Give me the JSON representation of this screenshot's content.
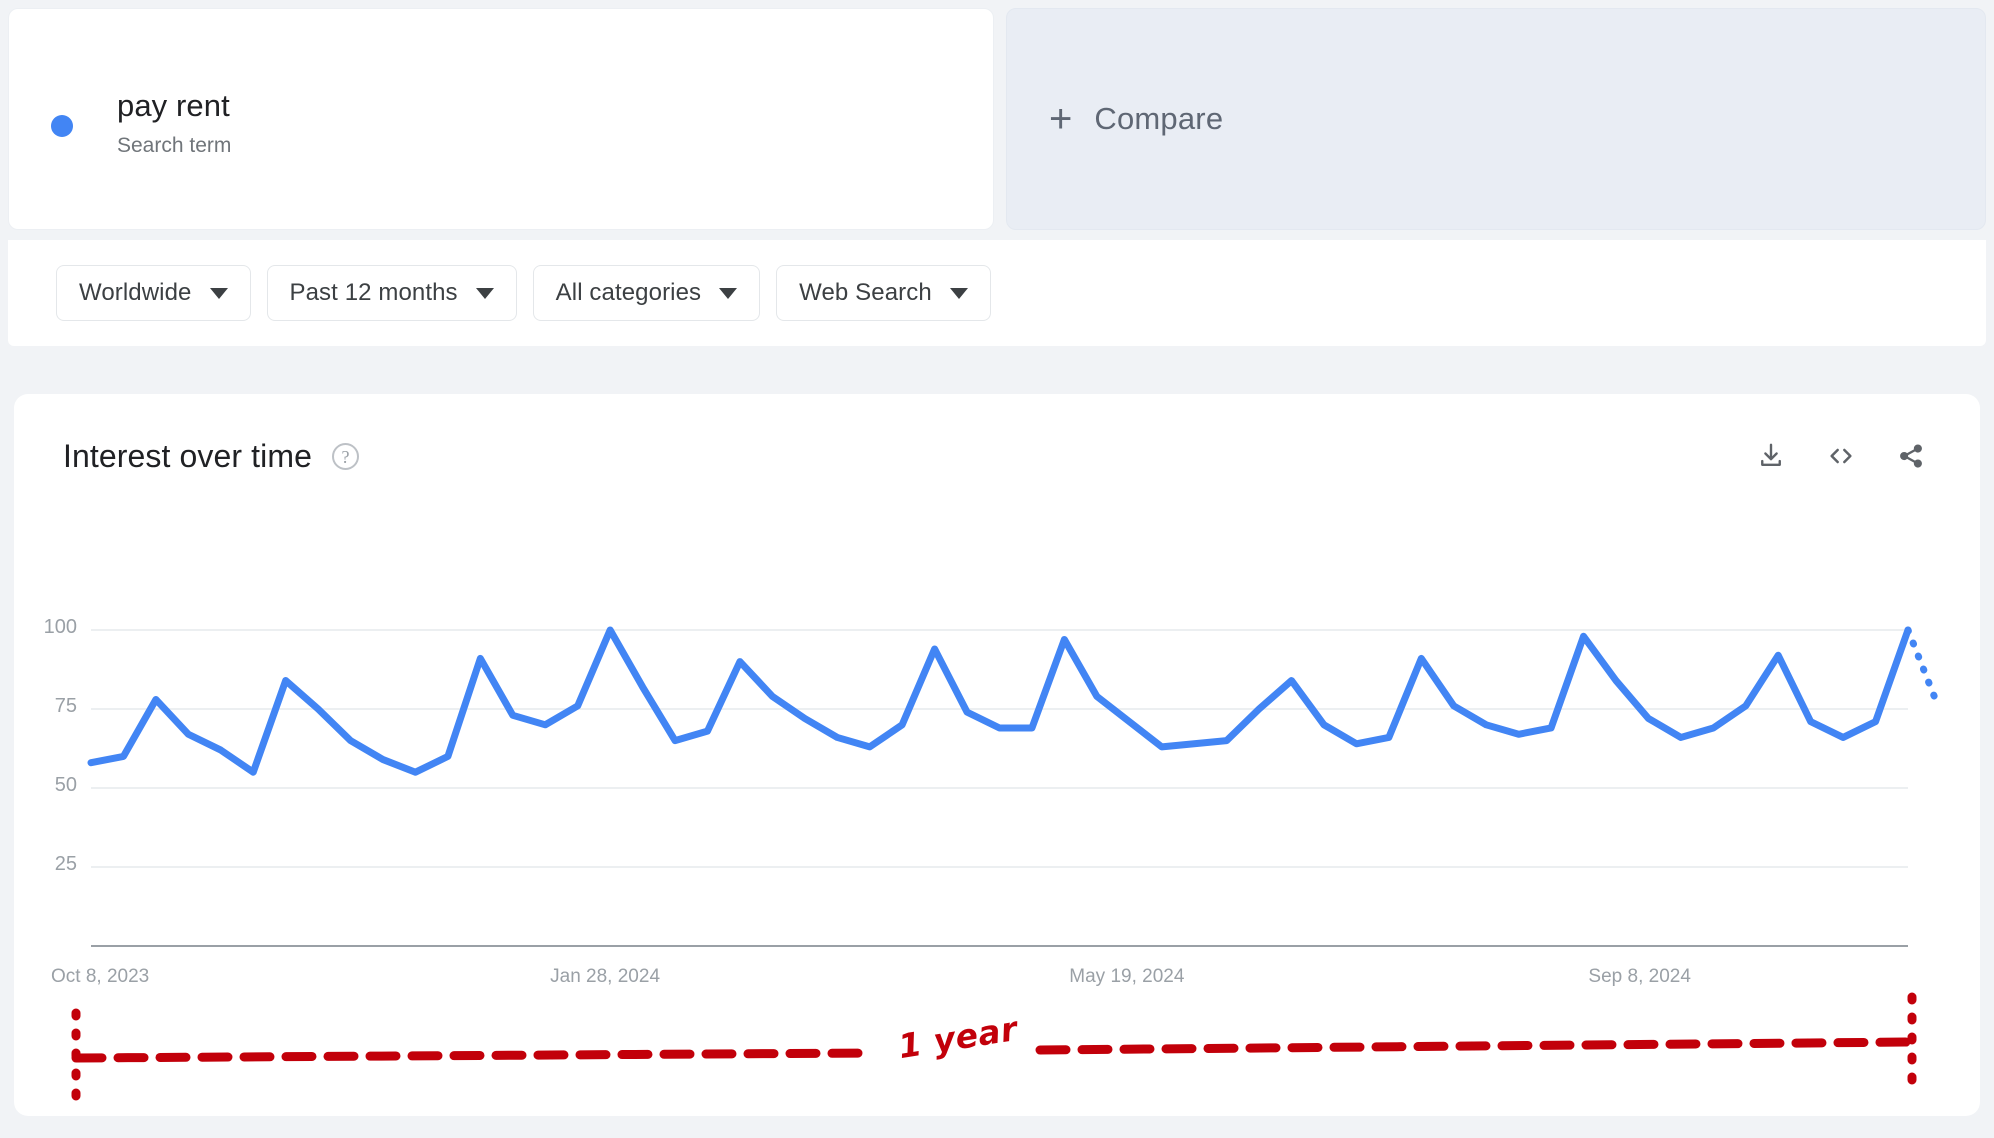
{
  "term_card": {
    "title": "pay rent",
    "subtitle": "Search term",
    "dot_color": "#4285f4"
  },
  "compare_card": {
    "plus": "+",
    "label": "Compare",
    "background": "#e9edf4"
  },
  "filters": [
    {
      "label": "Worldwide",
      "icon": "chevron-down-icon"
    },
    {
      "label": "Past 12 months",
      "icon": "chevron-down-icon"
    },
    {
      "label": "All categories",
      "icon": "chevron-down-icon"
    },
    {
      "label": "Web Search",
      "icon": "chevron-down-icon"
    }
  ],
  "chart_card": {
    "title": "Interest over time",
    "help_glyph": "?",
    "actions": [
      {
        "name": "download-icon",
        "label": "Download"
      },
      {
        "name": "embed-code-icon",
        "label": "Embed"
      },
      {
        "name": "share-icon",
        "label": "Share"
      }
    ]
  },
  "annotation": {
    "text": "1 year",
    "color": "#c2000a"
  },
  "chart_data": {
    "type": "line",
    "title": "Interest over time",
    "xlabel": "",
    "ylabel": "",
    "ylim": [
      0,
      100
    ],
    "yticks": [
      25,
      50,
      75,
      100
    ],
    "grid": true,
    "legend": "none",
    "line_color": "#4285f4",
    "partial_data_style": "dotted",
    "xtick_labels": [
      "Oct 8, 2023",
      "Jan 28, 2024",
      "May 19, 2024",
      "Sep 8, 2024"
    ],
    "xtick_positions": [
      0,
      16,
      32,
      48
    ],
    "series": [
      {
        "name": "pay rent",
        "values": [
          58,
          60,
          78,
          67,
          62,
          55,
          84,
          75,
          65,
          59,
          55,
          60,
          91,
          73,
          70,
          76,
          100,
          82,
          65,
          68,
          90,
          79,
          72,
          66,
          63,
          70,
          94,
          74,
          69,
          69,
          97,
          79,
          71,
          63,
          64,
          65,
          75,
          84,
          70,
          64,
          66,
          91,
          76,
          70,
          67,
          69,
          98,
          84,
          72,
          66,
          69,
          76,
          92,
          71,
          66,
          71,
          100
        ],
        "partial_tail": [
          100,
          76
        ]
      }
    ]
  }
}
